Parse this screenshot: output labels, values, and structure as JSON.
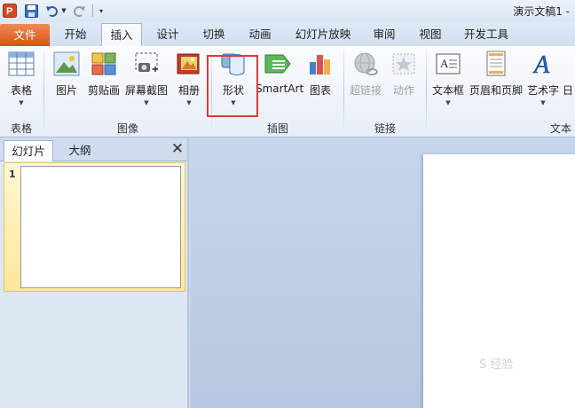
{
  "window": {
    "title": "演示文稿1 -"
  },
  "tabs": [
    {
      "label": "文件"
    },
    {
      "label": "开始"
    },
    {
      "label": "插入"
    },
    {
      "label": "设计"
    },
    {
      "label": "切换"
    },
    {
      "label": "动画"
    },
    {
      "label": "幻灯片放映"
    },
    {
      "label": "审阅"
    },
    {
      "label": "视图"
    },
    {
      "label": "开发工具"
    }
  ],
  "active_tab": "插入",
  "ribbon": {
    "groups": {
      "tables": "表格",
      "images": "图像",
      "illustrations": "插图",
      "links": "链接",
      "text": "文本"
    },
    "buttons": {
      "table": "表格",
      "picture": "图片",
      "clipart": "剪贴画",
      "screenshot": "屏幕截图",
      "album": "相册",
      "shapes": "形状",
      "smartart": "SmartArt",
      "chart": "图表",
      "hyperlink": "超链接",
      "action": "动作",
      "textbox": "文本框",
      "header_footer": "页眉和页脚",
      "wordart": "艺术字",
      "date": "日"
    }
  },
  "left_panel": {
    "tabs": {
      "slides": "幻灯片",
      "outline": "大纲"
    },
    "slide_number": "1"
  },
  "watermark": "S 经验"
}
